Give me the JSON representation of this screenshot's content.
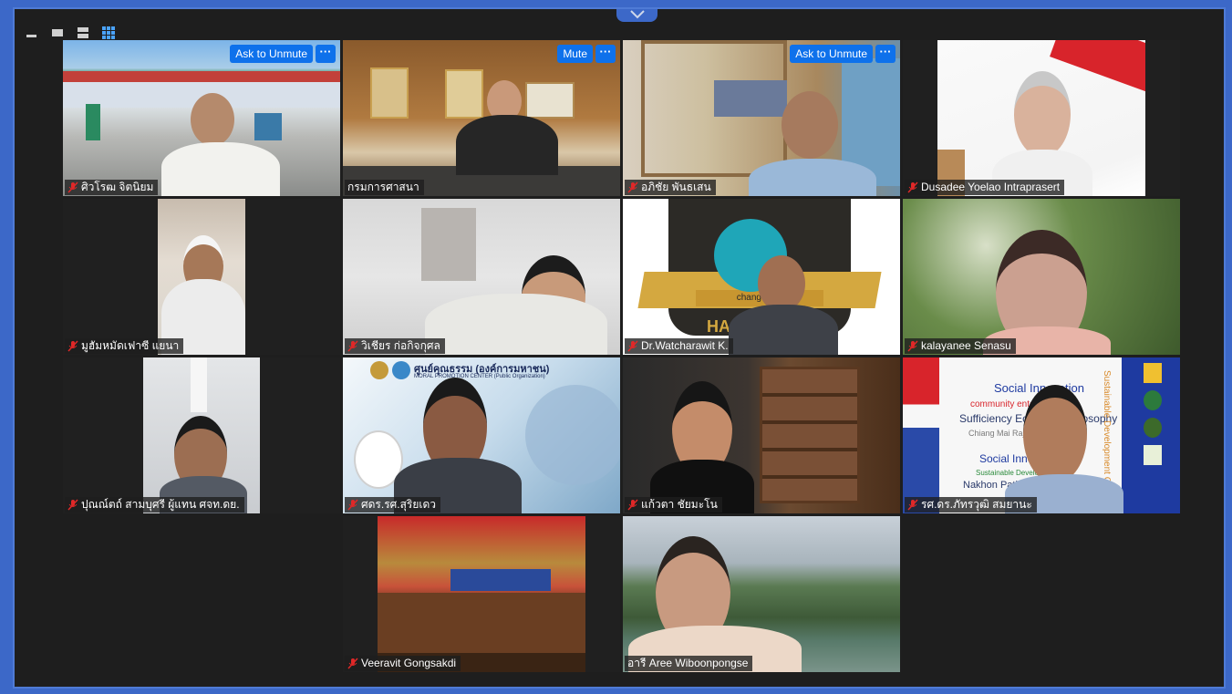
{
  "window": {
    "toolbar": {
      "minimize_icon": "minimize-icon",
      "speaker_view_icon": "speaker-view-icon",
      "strip_view_icon": "strip-view-icon",
      "gallery_view_icon": "gallery-view-icon",
      "collapse_icon": "chevron-down-icon"
    }
  },
  "tile_buttons": {
    "ask_to_unmute": "Ask to Unmute",
    "mute": "Mute",
    "more": "···"
  },
  "participants": [
    {
      "name": "ศิวโรฒ จิตนิยม",
      "muted": true
    },
    {
      "name": "กรมการศาสนา",
      "muted": false
    },
    {
      "name": "อภิชัย พันธเสน",
      "muted": true
    },
    {
      "name": "Dusadee Yoelao Intraprasert",
      "muted": true
    },
    {
      "name": "มูฮัมหมัดเฟาซี แยนา",
      "muted": true
    },
    {
      "name": "วิเชียร ก่อกิจกุศล",
      "muted": true
    },
    {
      "name": "Dr.Watcharawit K.",
      "muted": true
    },
    {
      "name": "kalayanee Senasu",
      "muted": true
    },
    {
      "name": "ปุณณ์ตถ์ สามบุศรี ผู้แทน ศจท.ดย.",
      "muted": true
    },
    {
      "name": "ศดร.รศ.สุริยเดว",
      "muted": true
    },
    {
      "name": "แก้วตา ชัยมะโน",
      "muted": true
    },
    {
      "name": "รศ.ดร.ภัทรวุฒิ สมยานะ",
      "muted": true
    },
    {
      "name": "Veeravit Gongsakdi",
      "muted": true
    },
    {
      "name": "อารี Aree Wiboonpongse",
      "muted": false
    }
  ],
  "backgrounds": {
    "t4_sign": "ศูนย์คุณธรรม (องค์การมหาชน)",
    "t4_sign_sub": "MORAL PROMOTION CENTER (Public Organization)",
    "t6_lines": [
      "Social Innovation",
      "community enterprise",
      "Sufficiency Economy Philosophy",
      "Chiang Mai Rajabhat",
      "Social Innovation",
      "Sustainable Development",
      "Nakhon Pathom"
    ],
    "t6_vertical": "Sustainable Development Goals",
    "t2_banner": "change-gro",
    "t2_banner2": "HA"
  },
  "colors": {
    "accent": "#0e71eb",
    "active_outline": "#e6e68a",
    "mic_muted": "#e02828"
  }
}
